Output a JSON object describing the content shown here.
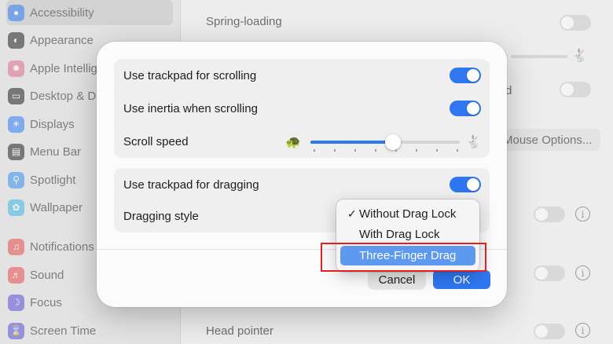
{
  "sidebar": {
    "items": [
      {
        "label": "Accessibility",
        "icon": "accessibility-icon",
        "color": "#2f7cf6",
        "selected": true
      },
      {
        "label": "Appearance",
        "icon": "appearance-icon",
        "color": "#222222"
      },
      {
        "label": "Apple Intellig",
        "icon": "apple-intelligence-icon",
        "color": "#e0708d"
      },
      {
        "label": "Desktop & Do",
        "icon": "desktop-dock-icon",
        "color": "#222222"
      },
      {
        "label": "Displays",
        "icon": "displays-icon",
        "color": "#2f7cf6"
      },
      {
        "label": "Menu Bar",
        "icon": "menu-bar-icon",
        "color": "#222222"
      },
      {
        "label": "Spotlight",
        "icon": "spotlight-icon",
        "color": "#3a8ef0"
      },
      {
        "label": "Wallpaper",
        "icon": "wallpaper-icon",
        "color": "#3fb4e8"
      },
      {
        "label": "Notifications",
        "icon": "notifications-icon",
        "color": "#e84b4b"
      },
      {
        "label": "Sound",
        "icon": "sound-icon",
        "color": "#e84b4b"
      },
      {
        "label": "Focus",
        "icon": "focus-icon",
        "color": "#5a4fd6"
      },
      {
        "label": "Screen Time",
        "icon": "screen-time-icon",
        "color": "#5a4fd6"
      }
    ]
  },
  "background": {
    "spring_loading": "Spring-loading",
    "mouse_options": "Mouse Options...",
    "head_pointer": "Head pointer",
    "d_fragment": "d"
  },
  "sheet": {
    "scroll_group": {
      "use_trackpad_scrolling": "Use trackpad for scrolling",
      "use_inertia": "Use inertia when scrolling",
      "scroll_speed": "Scroll speed",
      "scroll_speed_value": 0.55,
      "scroll_speed_ticks": 8
    },
    "drag_group": {
      "use_trackpad_dragging": "Use trackpad for dragging",
      "dragging_style": "Dragging style"
    },
    "cancel_label": "Cancel",
    "ok_label": "OK"
  },
  "toggles": {
    "scrolling": true,
    "inertia": true,
    "dragging": true
  },
  "menu": {
    "options": [
      "Without Drag Lock",
      "With Drag Lock",
      "Three-Finger Drag"
    ],
    "checked": "Without Drag Lock",
    "highlighted": "Three-Finger Drag",
    "checkmark": "✓"
  },
  "colors": {
    "accent": "#2f77f1",
    "highlight": "#5c99ef",
    "annotation": "#e32020"
  }
}
